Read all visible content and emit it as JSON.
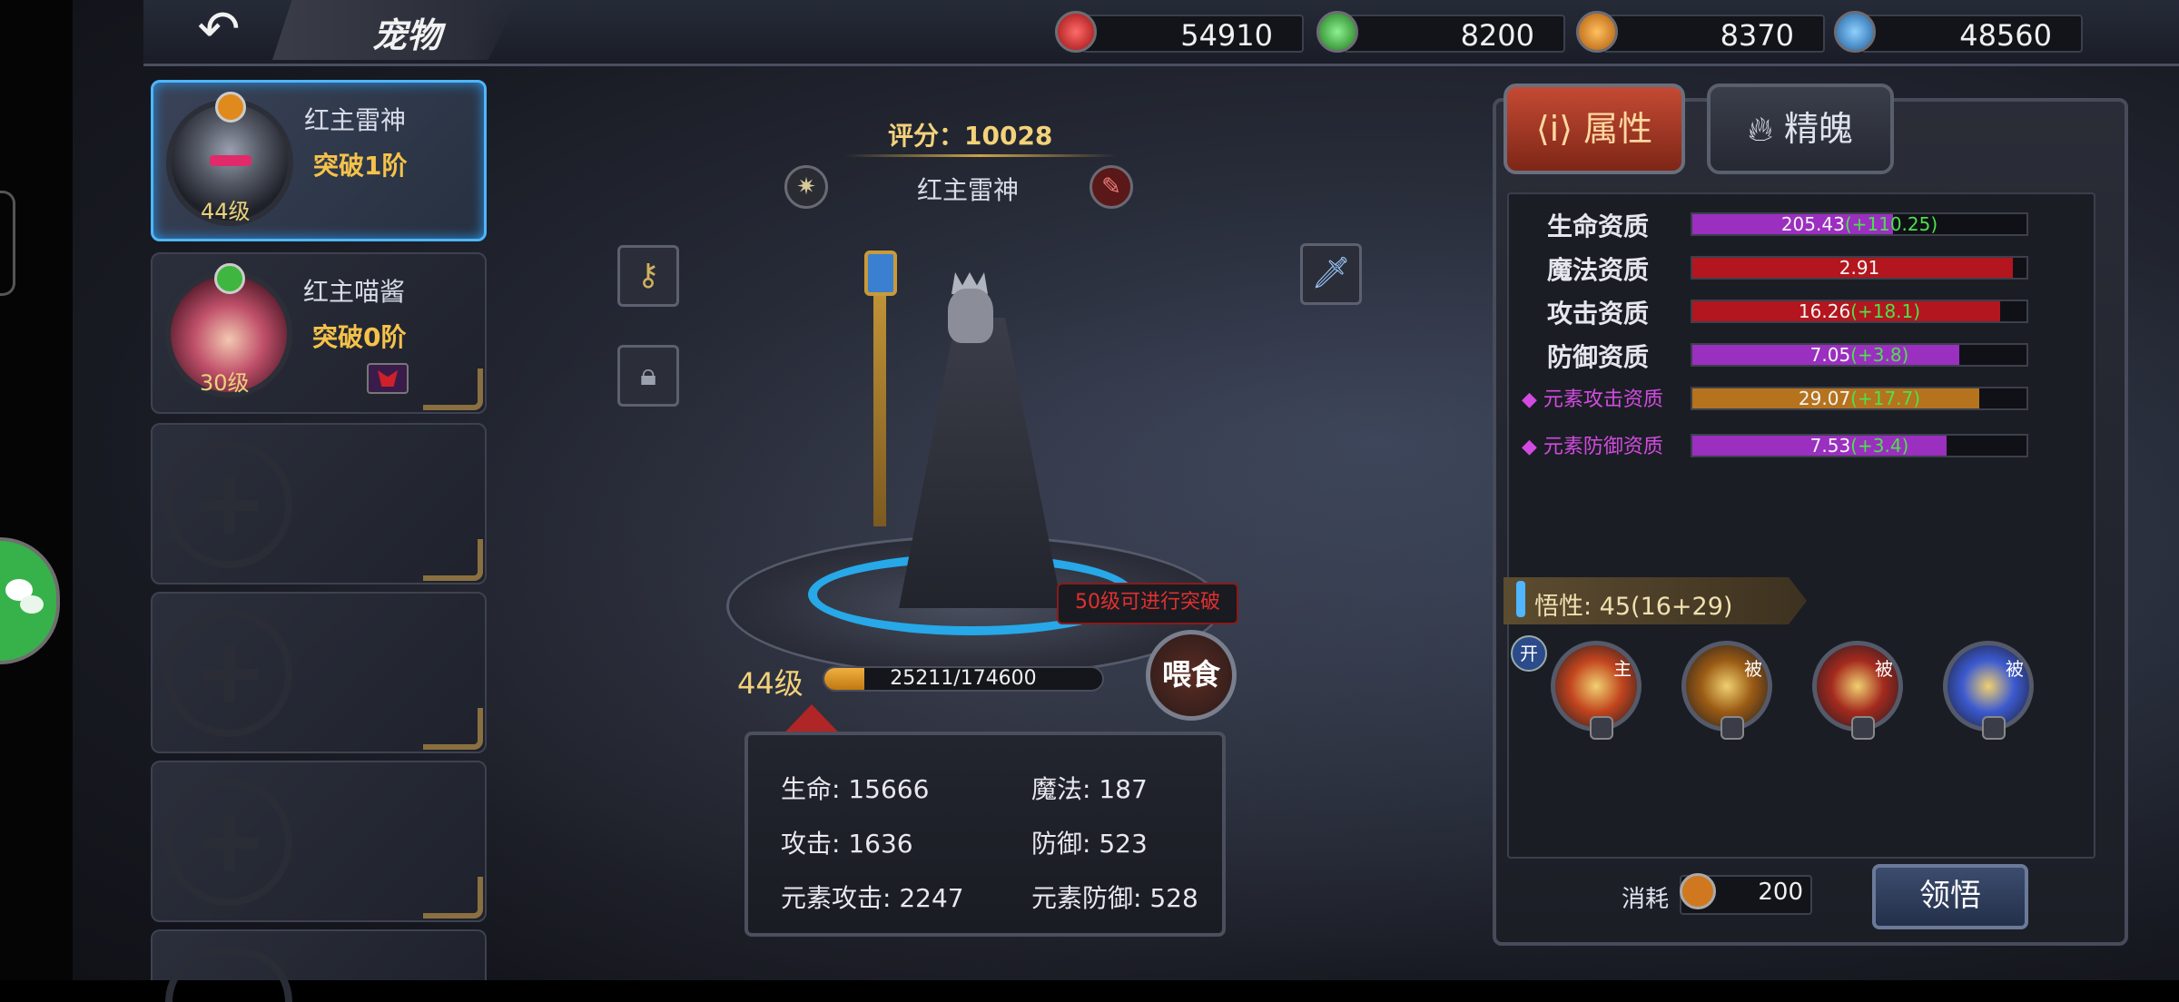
{
  "header": {
    "title": "宠物",
    "back_icon": "back-arrow-icon",
    "currencies": [
      {
        "icon": "red-gem-icon",
        "color": "#d62b2b",
        "value": "54910"
      },
      {
        "icon": "green-gem-icon",
        "color": "#3fb63f",
        "value": "8200"
      },
      {
        "icon": "lightning-coin-icon",
        "color": "#e08a1e",
        "value": "8370"
      },
      {
        "icon": "snowflake-gem-icon",
        "color": "#3a8fd8",
        "value": "48560"
      }
    ]
  },
  "pets": [
    {
      "name": "红主雷神",
      "breakthrough": "突破1阶",
      "level": "44级",
      "element_icon": "lightning-element-icon",
      "selected": true
    },
    {
      "name": "红主喵酱",
      "breakthrough": "突破0阶",
      "level": "30级",
      "element_icon": "leaf-element-icon",
      "selected": false
    }
  ],
  "empty_slots": 4,
  "center": {
    "score": "评分：10028",
    "pet_name": "红主雷神",
    "break_tip": "50级可进行突破",
    "feed_label": "喂食",
    "level": "44级",
    "exp_text": "25211/174600",
    "exp_progress": 0.1444,
    "stats": {
      "hp": "生命: 15666",
      "mp": "魔法: 187",
      "atk": "攻击: 1636",
      "def": "防御: 523",
      "elem_atk": "元素攻击: 2247",
      "elem_def": "元素防御: 528"
    }
  },
  "tabs": {
    "attributes": "属性",
    "soul": "精魄"
  },
  "aptitudes": [
    {
      "label": "生命资质",
      "value": "205.43",
      "bonus": "(+110.25)",
      "fill": 0.6,
      "color": "#9b2fc0",
      "element": false
    },
    {
      "label": "魔法资质",
      "value": "2.91",
      "bonus": "",
      "fill": 0.96,
      "color": "#b3161e",
      "element": false
    },
    {
      "label": "攻击资质",
      "value": "16.26",
      "bonus": "(+18.1)",
      "fill": 0.92,
      "color": "#b3161e",
      "element": false
    },
    {
      "label": "防御资质",
      "value": "7.05",
      "bonus": "(+3.8)",
      "fill": 0.8,
      "color": "#9b2fc0",
      "element": false
    },
    {
      "label": "◆ 元素攻击资质",
      "value": "29.07",
      "bonus": "(+17.7)",
      "fill": 0.86,
      "color": "#b5731e",
      "element": true
    },
    {
      "label": "◆ 元素防御资质",
      "value": "7.53",
      "bonus": "(+3.4)",
      "fill": 0.76,
      "color": "#9b2fc0",
      "element": true
    }
  ],
  "wisdom": "悟性: 45(16+29)",
  "skills_toggle": "开",
  "skills": [
    {
      "tag": "主",
      "icon": "lightning-fist-skill-icon",
      "color": "#c2451e"
    },
    {
      "tag": "被",
      "icon": "golden-burst-skill-icon",
      "color": "#9a5a14"
    },
    {
      "tag": "被",
      "icon": "red-lightning-skill-icon",
      "color": "#a42a1e"
    },
    {
      "tag": "被",
      "icon": "blue-crystal-skill-icon",
      "color": "#3c5ad0"
    }
  ],
  "cost": {
    "label": "消耗",
    "value": "200"
  },
  "comprehend_label": "领悟"
}
